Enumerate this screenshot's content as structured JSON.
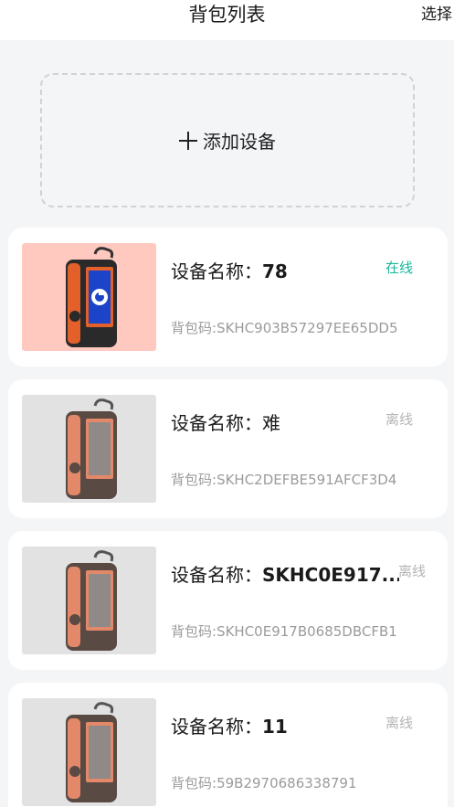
{
  "header": {
    "title": "背包列表",
    "select_label": "选择"
  },
  "add_device": {
    "label": "添加设备"
  },
  "devices": [
    {
      "name_label": "设备名称：",
      "name": "78",
      "status": "在线",
      "status_type": "online",
      "code_label": "背包码:",
      "code": "SKHC903B57297EE65DD5"
    },
    {
      "name_label": "设备名称：",
      "name": "难",
      "status": "离线",
      "status_type": "offline",
      "code_label": "背包码:",
      "code": "SKHC2DEFBE591AFCF3D4"
    },
    {
      "name_label": "设备名称：",
      "name": "SKHC0E917...",
      "status": "离线",
      "status_type": "offline",
      "code_label": "背包码:",
      "code": "SKHC0E917B0685DBCFB1"
    },
    {
      "name_label": "设备名称：",
      "name": "11",
      "status": "离线",
      "status_type": "offline",
      "code_label": "背包码:",
      "code": "59B2970686338791"
    }
  ],
  "colors": {
    "online": "#19b79a",
    "offline": "#b4b4b4",
    "online_thumb_bg": "#ffc9c0",
    "offline_thumb_bg": "#e2e2e2"
  }
}
